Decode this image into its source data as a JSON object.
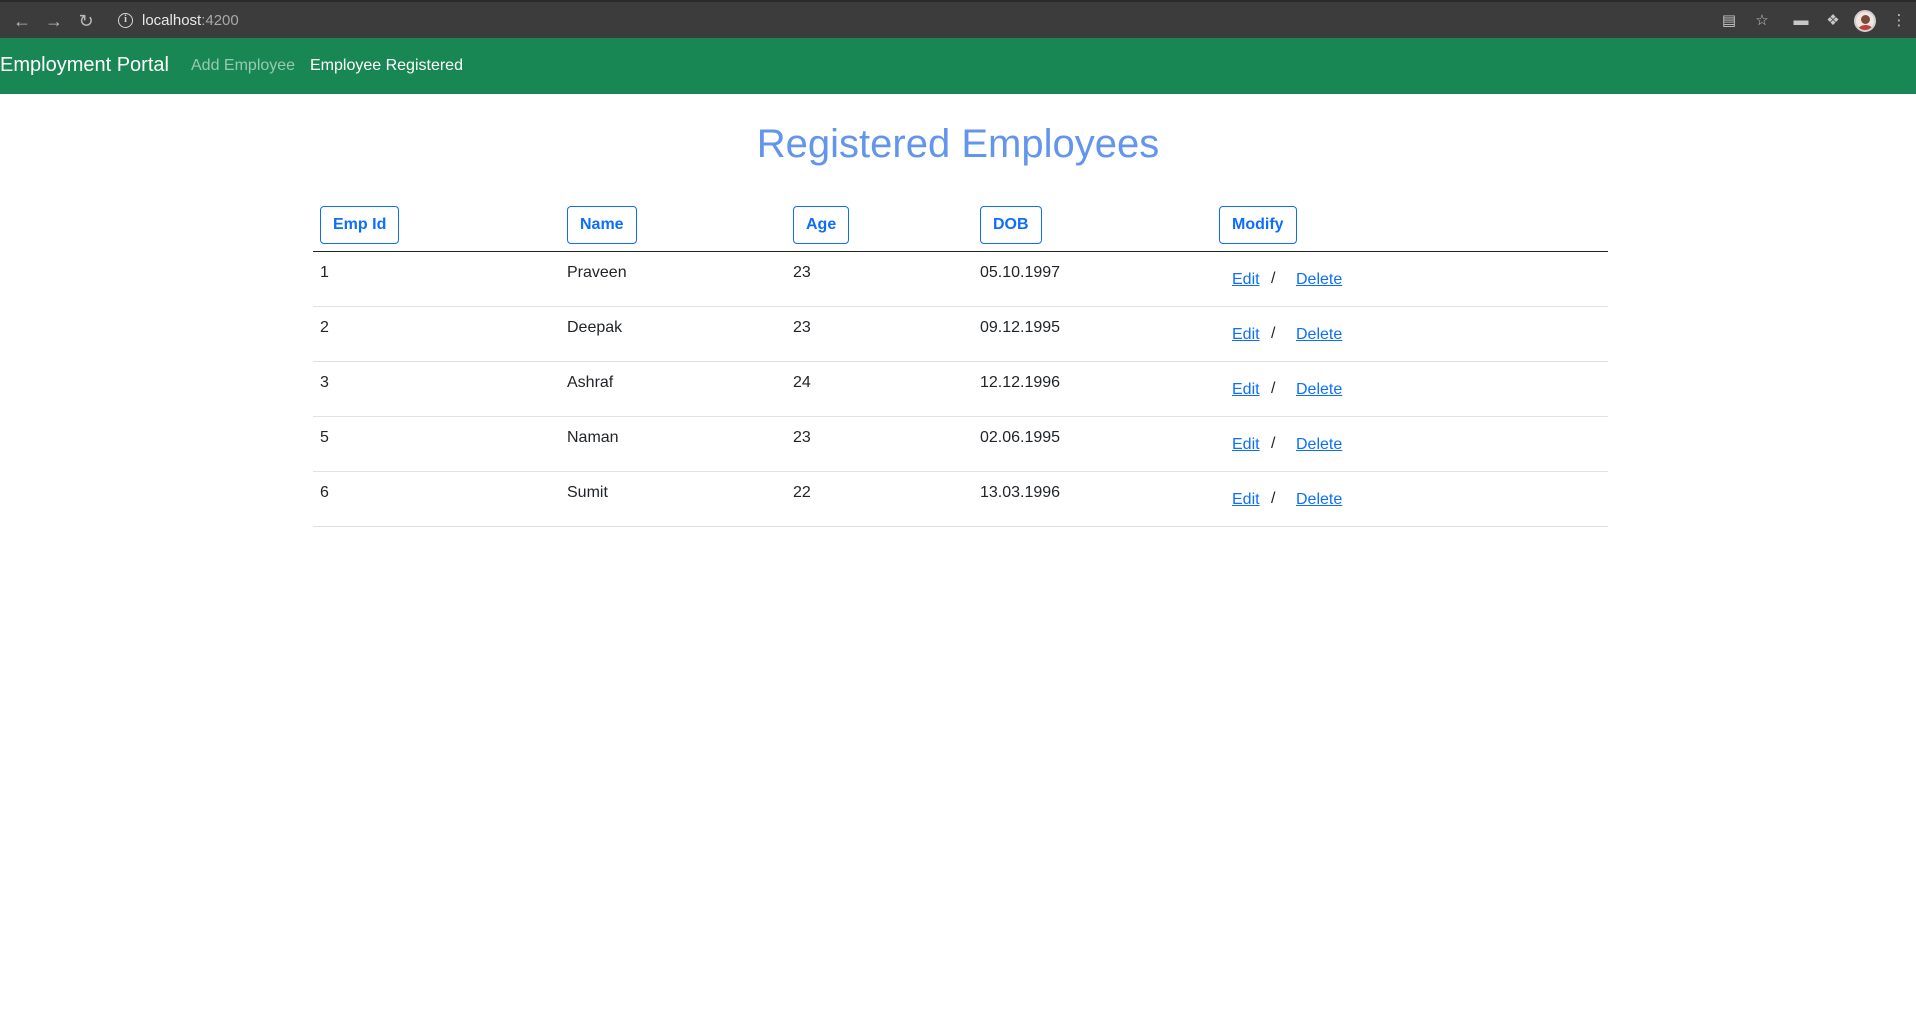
{
  "browser": {
    "url_host": "localhost",
    "url_port": ":4200",
    "icons": [
      "back-icon",
      "forward-icon",
      "reload-icon",
      "info-icon",
      "cast-icon",
      "star-icon",
      "tab-strip-icon",
      "extensions-icon",
      "profile-avatar",
      "menu-icon"
    ]
  },
  "navbar": {
    "brand": "Employment Portal",
    "links": [
      {
        "label": "Add Employee",
        "active": false
      },
      {
        "label": "Employee Registered",
        "active": true
      }
    ],
    "color": "#198754"
  },
  "page": {
    "title": "Registered Employees",
    "title_color": "#6495ed"
  },
  "table": {
    "headers": [
      "Emp Id",
      "Name",
      "Age",
      "DOB",
      "Modify"
    ],
    "rows": [
      {
        "id": "1",
        "name": "Praveen",
        "age": "23",
        "dob": "05.10.1997"
      },
      {
        "id": "2",
        "name": "Deepak",
        "age": "23",
        "dob": "09.12.1995"
      },
      {
        "id": "3",
        "name": "Ashraf",
        "age": "24",
        "dob": "12.12.1996"
      },
      {
        "id": "5",
        "name": "Naman",
        "age": "23",
        "dob": "02.06.1995"
      },
      {
        "id": "6",
        "name": "Sumit",
        "age": "22",
        "dob": "13.03.1996"
      }
    ],
    "edit_label": "Edit",
    "separator": "/",
    "delete_label": "Delete",
    "accent_color": "#0d6efd"
  }
}
